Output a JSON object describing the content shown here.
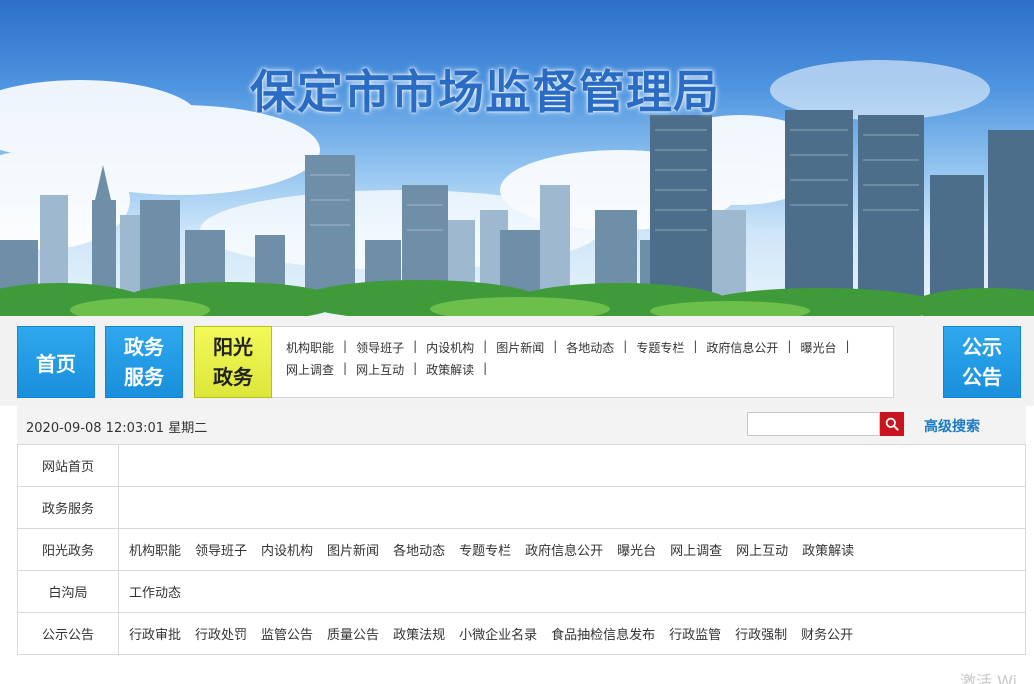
{
  "header": {
    "site_title": "保定市市场监督管理局"
  },
  "nav": {
    "home_label": "首页",
    "gov_service_line1": "政务",
    "gov_service_line2": "服务",
    "sunshine_line1": "阳光",
    "sunshine_line2": "政务",
    "notice_line1": "公示",
    "notice_line2": "公告",
    "sunshine_links_row1": [
      "机构职能",
      "领导班子",
      "内设机构",
      "图片新闻",
      "各地动态",
      "专题专栏",
      "政府信息公开",
      "曝光台"
    ],
    "sunshine_links_row2": [
      "网上调查",
      "网上互动",
      "政策解读"
    ]
  },
  "info_bar": {
    "datetime": "2020-09-08 12:03:01 星期二",
    "search_placeholder": "",
    "advanced_search_label": "高级搜索"
  },
  "sitemap": [
    {
      "category": "网站首页",
      "links": []
    },
    {
      "category": "政务服务",
      "links": []
    },
    {
      "category": "阳光政务",
      "links": [
        "机构职能",
        "领导班子",
        "内设机构",
        "图片新闻",
        "各地动态",
        "专题专栏",
        "政府信息公开",
        "曝光台",
        "网上调查",
        "网上互动",
        "政策解读"
      ]
    },
    {
      "category": "白沟局",
      "links": [
        "工作动态"
      ]
    },
    {
      "category": "公示公告",
      "links": [
        "行政审批",
        "行政处罚",
        "监管公告",
        "质量公告",
        "政策法规",
        "小微企业名录",
        "食品抽检信息发布",
        "行政监管",
        "行政强制",
        "财务公开"
      ]
    }
  ],
  "watermark": "激活 Wi",
  "colors": {
    "title_blue": "#2a6bc4",
    "nav_blue": "#1a8fdc",
    "nav_yellow": "#dde63a",
    "search_red": "#c8141e",
    "link_blue": "#1c7bc4"
  },
  "icons": [
    "search-icon"
  ]
}
